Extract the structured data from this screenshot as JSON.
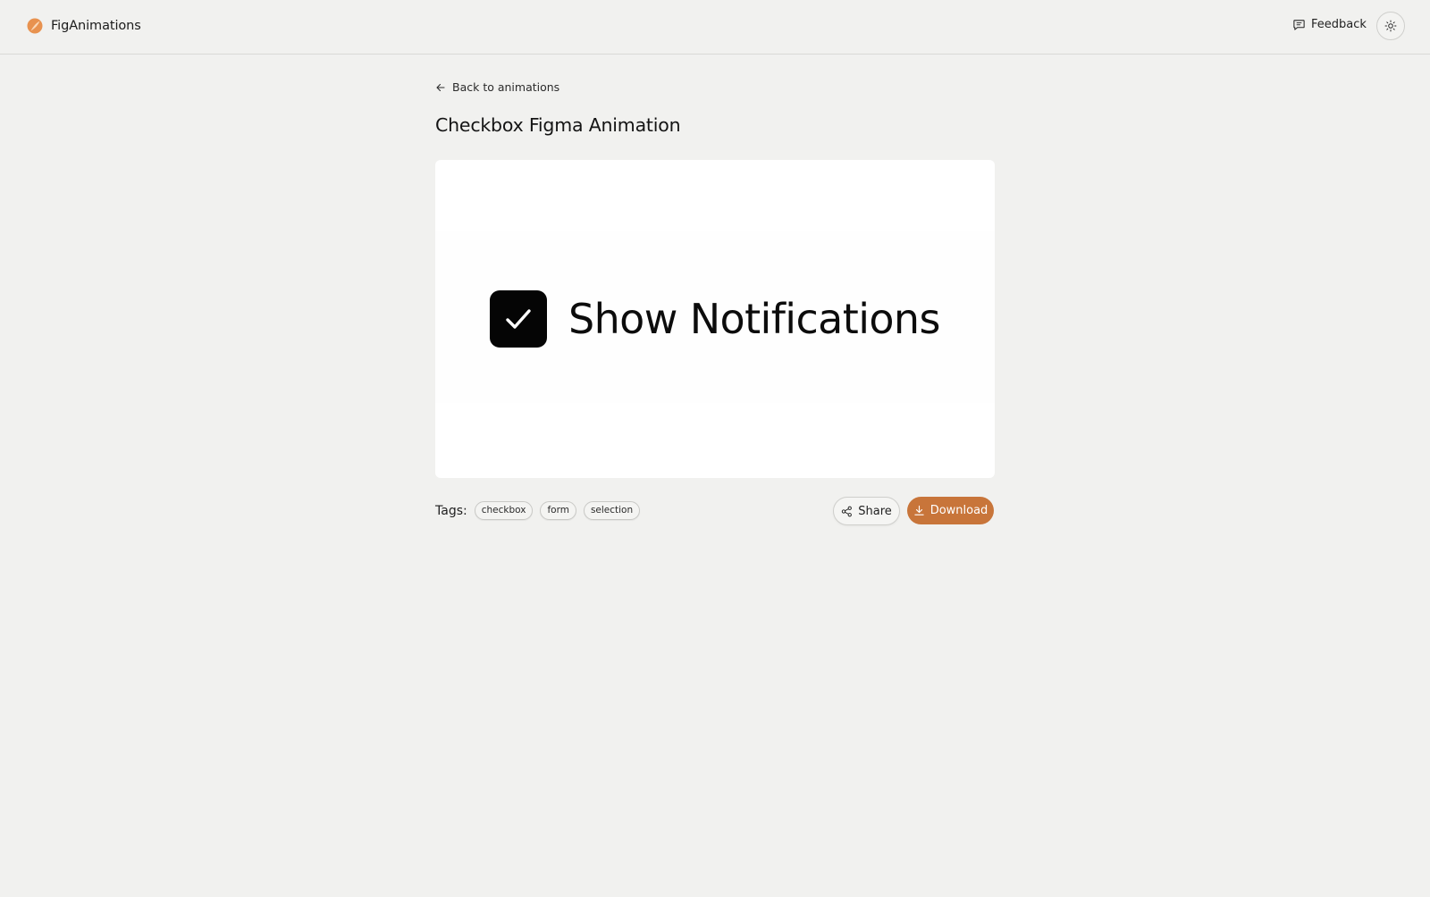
{
  "header": {
    "brand_name": "FigAnimations",
    "feedback_label": "Feedback"
  },
  "nav": {
    "back_label": "Back to animations"
  },
  "page": {
    "title": "Checkbox Figma Animation"
  },
  "preview": {
    "checkbox_checked": true,
    "label": "Show Notifications"
  },
  "tags": {
    "label": "Tags:",
    "items": [
      "checkbox",
      "form",
      "selection"
    ]
  },
  "actions": {
    "share_label": "Share",
    "download_label": "Download"
  },
  "colors": {
    "background": "#f1f1ef",
    "accent": "#c8753a",
    "logo_orange": "#e8924f"
  },
  "icons": {
    "brand": "brand-logo-icon",
    "feedback": "message-square-icon",
    "theme": "sun-icon",
    "back": "arrow-left-icon",
    "checkbox": "check-icon",
    "share": "share-icon",
    "download": "download-icon"
  }
}
